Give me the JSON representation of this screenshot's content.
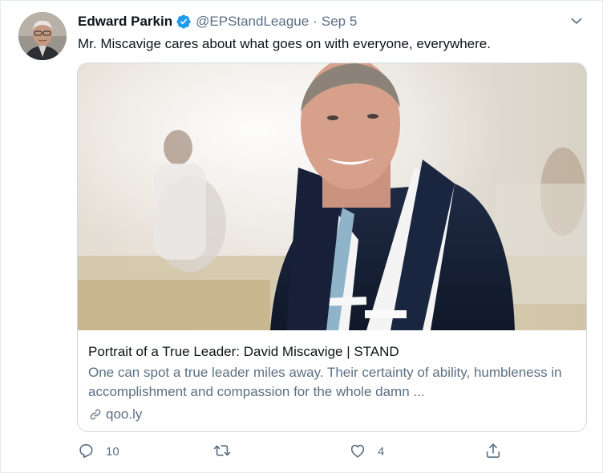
{
  "tweet": {
    "author_name": "Edward Parkin",
    "handle": "@EPStandLeague",
    "separator": "·",
    "date": "Sep 5",
    "text": "Mr. Miscavige cares about what goes on with everyone, everywhere."
  },
  "card": {
    "title": "Portrait of a True Leader: David Miscavige | STAND",
    "description": "One can spot a true leader miles away. Their certainty of ability, humbleness in accomplishment and compassion for the whole damn ...",
    "domain": "qoo.ly"
  },
  "actions": {
    "reply_count": "10",
    "retweet_count": "",
    "like_count": "4"
  },
  "icons": {
    "verified": "verified-badge-icon",
    "caret": "chevron-down-icon",
    "link": "link-icon",
    "reply": "reply-icon",
    "retweet": "retweet-icon",
    "like": "heart-icon",
    "share": "share-icon"
  },
  "colors": {
    "verified_blue": "#1d9bf0",
    "secondary_text": "#5b7083",
    "border": "#cfd9de"
  }
}
